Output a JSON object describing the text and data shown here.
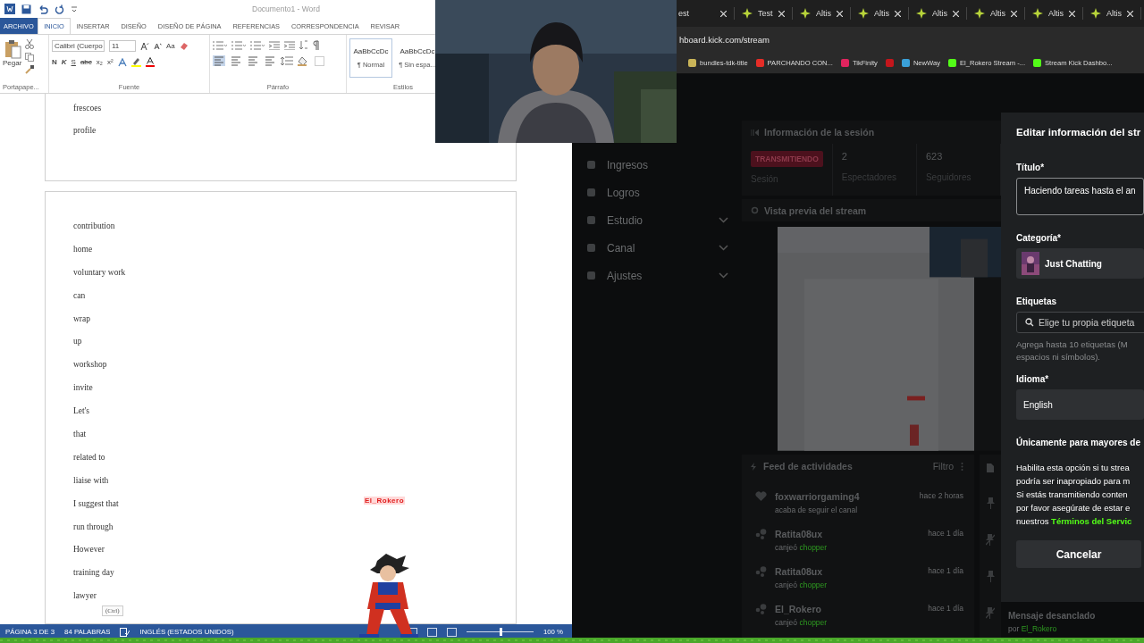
{
  "word": {
    "title": "Documento1 - Word",
    "tabs": [
      {
        "label": "ARCHIVO",
        "kind": "file",
        "selected": false
      },
      {
        "label": "INICIO",
        "kind": "tab",
        "selected": true
      },
      {
        "label": "INSERTAR",
        "kind": "tab",
        "selected": false
      },
      {
        "label": "DISEÑO",
        "kind": "tab",
        "selected": false
      },
      {
        "label": "DISEÑO DE PÁGINA",
        "kind": "tab",
        "selected": false
      },
      {
        "label": "REFERENCIAS",
        "kind": "tab",
        "selected": false
      },
      {
        "label": "CORRESPONDENCIA",
        "kind": "tab",
        "selected": false
      },
      {
        "label": "REVISAR",
        "kind": "tab",
        "selected": false
      }
    ],
    "paste_label": "Pegar",
    "font_name": "Calibri (Cuerpo",
    "font_size": "11",
    "case_button": "Aa",
    "format_buttons": [
      "N",
      "K",
      "S",
      "abc",
      "x₂",
      "x²"
    ],
    "styles": [
      {
        "preview": "AaBbCcDc",
        "name": "¶ Normal",
        "selected": true
      },
      {
        "preview": "AaBbCcDc",
        "name": "¶ Sin espa...",
        "selected": false
      }
    ],
    "groups": [
      "Portapape...",
      "Fuente",
      "Párrafo",
      "Estilos"
    ],
    "page1_words": [
      "frescoes",
      "profile"
    ],
    "page2_words": [
      "contribution",
      "home",
      "voluntary work",
      "can",
      "wrap",
      "up",
      "workshop",
      "invite",
      "Let's",
      "that",
      "related to",
      "liaise with",
      "I suggest that",
      "run through",
      "However",
      "training day",
      "lawyer"
    ],
    "paste_tag": "(Ctrl)",
    "status": {
      "page": "PÁGINA 3 DE 3",
      "words": "84 PALABRAS",
      "language": "INGLÉS (ESTADOS UNIDOS)",
      "zoom": "100 %",
      "level": 0.5
    }
  },
  "browser": {
    "tabs": [
      {
        "label": "est",
        "icon": false
      },
      {
        "label": "Test",
        "icon": true
      },
      {
        "label": "Altis",
        "icon": true
      },
      {
        "label": "Altis",
        "icon": true
      },
      {
        "label": "Altis",
        "icon": true
      },
      {
        "label": "Altis",
        "icon": true
      },
      {
        "label": "Altis",
        "icon": true
      },
      {
        "label": "Altis",
        "icon": true
      }
    ],
    "url": "hboard.kick.com/stream",
    "bookmarks": [
      {
        "label": "bundles-tdk-title",
        "color": "#c9b458"
      },
      {
        "label": "PARCHANDO CON...",
        "color": "#e52d27"
      },
      {
        "label": "TikFinity",
        "color": "#e0245e"
      },
      {
        "color": "#c4161c"
      },
      {
        "label": "NewWay",
        "color": "#3aa0d8"
      },
      {
        "label": "El_Rokero Stream -...",
        "color": "#53fc18"
      },
      {
        "label": "Stream Kick Dashbo...",
        "color": "#53fc18"
      }
    ]
  },
  "dashboard": {
    "sidebar": [
      {
        "label": "Ingresos",
        "expandable": false
      },
      {
        "label": "Logros",
        "expandable": false
      },
      {
        "label": "Estudio",
        "expandable": true
      },
      {
        "label": "Canal",
        "expandable": true
      },
      {
        "label": "Ajustes",
        "expandable": true
      }
    ],
    "session_title": "Información de la sesión",
    "status_badge": "TRANSMITIENDO",
    "stats": [
      {
        "label": "Sesión"
      },
      {
        "value": "2",
        "label": "Espectadores"
      },
      {
        "value": "623",
        "label": "Seguidores"
      }
    ],
    "preview_title": "Vista previa del stream",
    "feed_title": "Feed de actividades",
    "feed_filter": "Filtro",
    "feed": [
      {
        "kind": "follow",
        "user": "foxwarriorgaming4",
        "action": "acaba de seguir el canal",
        "time": "hace 2 horas"
      },
      {
        "kind": "redeem",
        "user": "Ratita08ux",
        "action": "canjeó",
        "reward": "chopper",
        "time": "hace 1 día"
      },
      {
        "kind": "redeem",
        "user": "Ratita08ux",
        "action": "canjeó",
        "reward": "chopper",
        "time": "hace 1 día"
      },
      {
        "kind": "redeem",
        "user": "El_Rokero",
        "action": "canjeó",
        "reward": "chopper",
        "time": "hace 1 día"
      }
    ],
    "pinned": {
      "title": "Mensaje desanclado",
      "by": "por",
      "user": "El_Rokero"
    }
  },
  "modal": {
    "title": "Editar información del str",
    "title_label": "Título*",
    "title_value": "Haciendo tareas hasta el an",
    "category_label": "Categoría*",
    "category": "Just Chatting",
    "tags_label": "Etiquetas",
    "tags_placeholder": "Elige tu propia etiqueta",
    "tags_hint": "Agrega hasta 10 etiquetas (M\nespacios ni símbolos).",
    "language_label": "Idioma*",
    "language": "English",
    "mature_label": "Únicamente para mayores de",
    "mature_text": "Habilita esta opción si tu strea\npodría ser inapropiado para m\nSi estás transmitiendo conten\npor favor asegúrate de estar e\nnuestros",
    "mature_link": "Términos del Servic",
    "cancel": "Cancelar"
  },
  "overlay": {
    "name_tag": "El_Rokero"
  }
}
